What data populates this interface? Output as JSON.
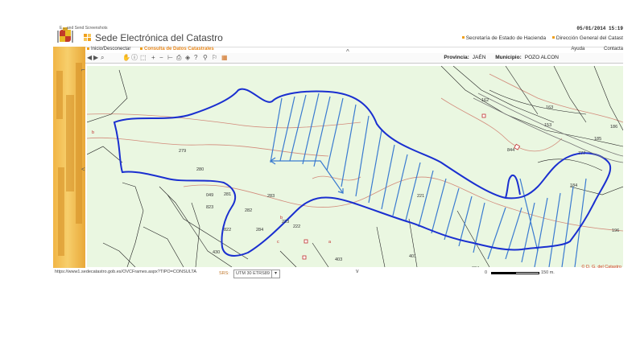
{
  "header": {
    "caption": "E... and Send Screenshots",
    "date": "05/01/2014 15:19",
    "title": "Sede Electrónica del Catastro",
    "link1": "Secretaría de Estado de Hacienda",
    "link2": "Dirección General del Catast"
  },
  "menu": {
    "inicio": "Inicio/Desconectar",
    "consulta": "Consulta de Datos Catastrales",
    "ayuda": "Ayuda",
    "contacta": "Contacta"
  },
  "location": {
    "provincia_label": "Provincia:",
    "provincia": "JAÉN",
    "municipio_label": "Municipio:",
    "municipio": "POZO ALCON"
  },
  "toolbar_icons": [
    "back-icon",
    "forward-icon",
    "zoom-icon",
    "pan-icon",
    "info-icon",
    "select-icon",
    "zoom-in-icon",
    "zoom-out-icon",
    "measure-icon",
    "print-icon",
    "layers-icon",
    "help-icon",
    "marker-icon",
    "link-icon",
    "export-icon"
  ],
  "map": {
    "parcels": {
      "p162": "162",
      "p163": "163",
      "p153": "153",
      "p186": "186",
      "p185": "185",
      "p844": "844",
      "p777": "777",
      "p184": "184",
      "p196": "196",
      "p197": "197",
      "p682": "682",
      "p684": "684",
      "p401": "401",
      "p398": "398",
      "p403": "403",
      "p382": "382",
      "p430": "430",
      "p279": "279",
      "p280": "280",
      "p281": "281",
      "p283": "283",
      "p282": "282",
      "p284": "284",
      "p823": "823",
      "p822": "822",
      "p223": "223",
      "p222": "222",
      "p221": "221",
      "p696": "696",
      "p819": "819",
      "p427": "427",
      "p049": "049"
    },
    "subparcel_marks": {
      "a": "a",
      "b": "b",
      "c": "c"
    },
    "colors": {
      "background": "#eaf7e1",
      "boundary": "#1a2fd0",
      "hatch": "#3a7bd0",
      "contour": "#d28a7a"
    }
  },
  "status": {
    "url": "https://www1.sedecatastro.gob.es/OVCFrames.aspx?TIPO=CONSULTA",
    "srs_label": "SRS:",
    "srs_value": "UTM 30 ETRS89",
    "scale_start": "0",
    "scale_end": "150 m.",
    "copyright": "© D. G. del Catastro"
  },
  "nav": {
    "up": "^",
    "down": "v",
    "left": "<"
  }
}
